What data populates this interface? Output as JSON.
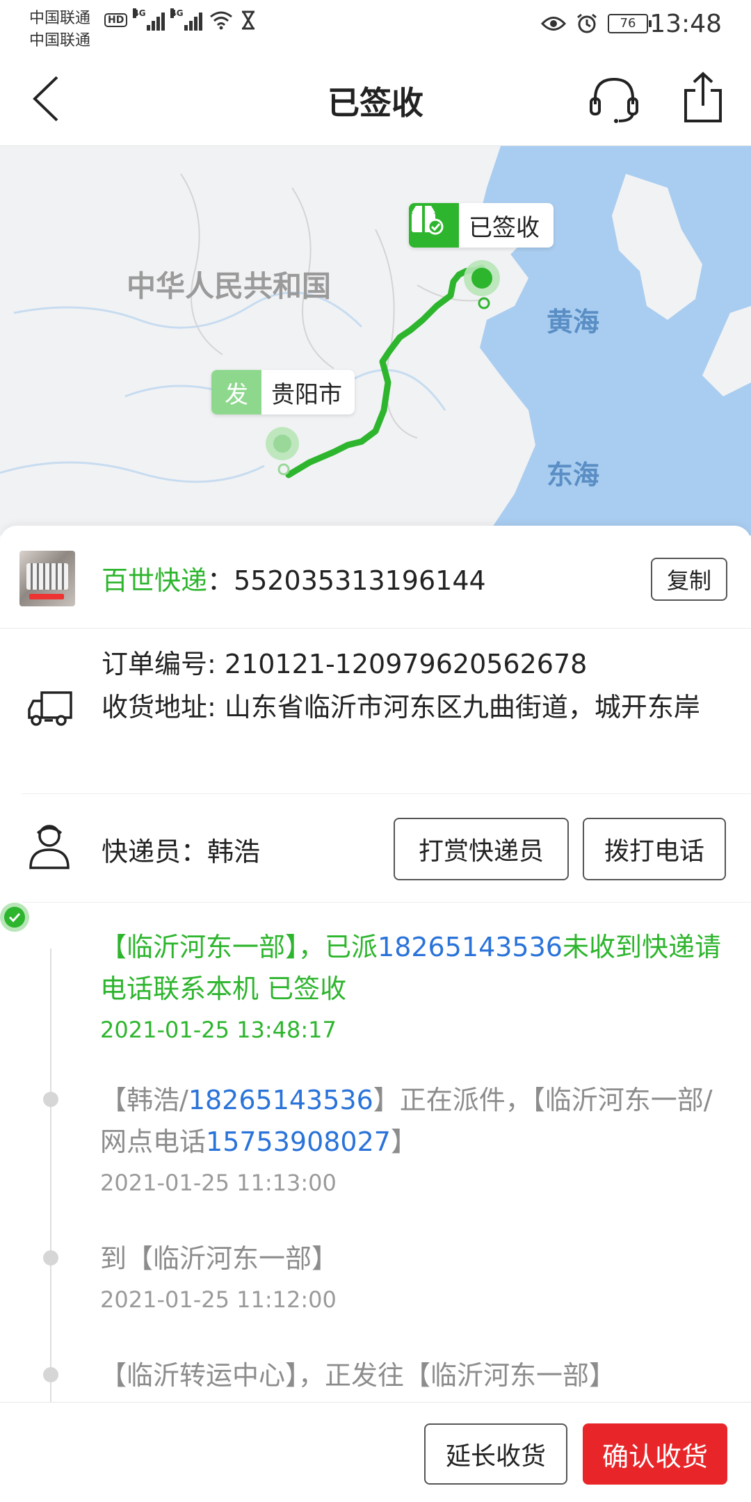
{
  "status_bar": {
    "carrier1": "中国联通",
    "carrier2": "中国联通",
    "hd": "HD",
    "net1": "4G",
    "net2": "4G",
    "battery": "76",
    "time": "13:48"
  },
  "header": {
    "title": "已签收"
  },
  "map": {
    "country_label": "中华人民共和国",
    "sea1_label": "黄海",
    "sea2_label": "东海",
    "signed_label": "已签收",
    "from_tag": "发",
    "from_city": "贵阳市"
  },
  "shipment": {
    "courier_company": "百世快递",
    "separator": "：",
    "tracking_number": "552035313196144",
    "copy_label": "复制"
  },
  "order": {
    "order_no_label": "订单编号: ",
    "order_no": "210121-120979620562678",
    "address_label": "收货地址: ",
    "address": "山东省临沂市河东区九曲街道，城开东岸"
  },
  "rider": {
    "label": "快递员：",
    "name": "韩浩",
    "tip_button": "打赏快递员",
    "call_button": "拨打电话"
  },
  "timeline": [
    {
      "part1": "【临沂河东一部】，已派",
      "phone": "18265143536",
      "part2": "未收到快递请电话联系本机 已签收",
      "time": "2021-01-25 13:48:17"
    },
    {
      "part1": "【韩浩/",
      "phone": "18265143536",
      "part2": "】正在派件，【临沂河东一部/网点电话",
      "phone2": "15753908027",
      "part3": "】",
      "time": "2021-01-25 11:13:00"
    },
    {
      "part1": "到【临沂河东一部】",
      "time": "2021-01-25 11:12:00"
    },
    {
      "part1": "【临沂转运中心】，正发往【临沂河东一部】"
    }
  ],
  "bottom": {
    "extend_button": "延长收货",
    "confirm_button": "确认收货"
  },
  "colors": {
    "accent_green": "#2db52d",
    "phone_blue": "#2a73d9",
    "confirm_red": "#e8262a"
  }
}
